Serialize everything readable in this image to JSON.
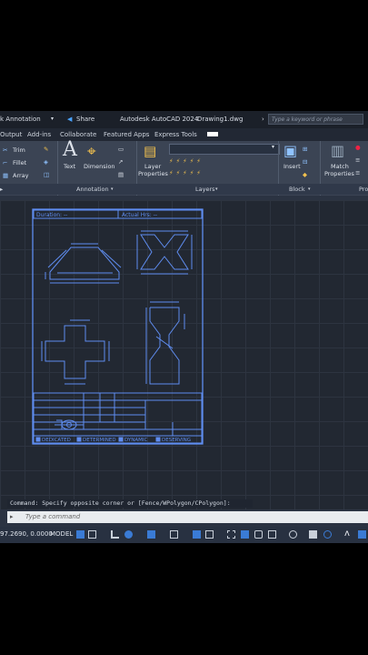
{
  "titlebar": {
    "workspace": "k Annotation",
    "share": "Share",
    "title": "Autodesk AutoCAD 2024",
    "filename": "Drawing1.dwg",
    "search_placeholder": "Type a keyword or phrase"
  },
  "tabs": [
    "Output",
    "Add-ins",
    "Collaborate",
    "Featured Apps",
    "Express Tools"
  ],
  "ribbon": {
    "modify": {
      "trim": "Trim",
      "fillet": "Fillet",
      "array": "Array"
    },
    "annotation": {
      "text": "Text",
      "dimension": "Dimension"
    },
    "layers": {
      "layer_properties_line1": "Layer",
      "layer_properties_line2": "Properties"
    },
    "block": {
      "insert": "Insert"
    },
    "properties": {
      "match_line1": "Match",
      "match_line2": "Properties"
    },
    "panels": {
      "annotation": "Annotation",
      "layers": "Layers",
      "block": "Block",
      "properties_cut": "Pro"
    }
  },
  "drawing": {
    "header_duration": "Duration: --",
    "header_actual": "Actual Hrs: --",
    "checkbox_1": "DEDICATED",
    "checkbox_2": "DETERMINED",
    "checkbox_3": "DYNAMIC",
    "checkbox_4": "DESERVING"
  },
  "command": {
    "history": "Command: Specify opposite corner or [Fence/WPolygon/CPolygon]:",
    "placeholder": "Type a command"
  },
  "status": {
    "coords": "97.2690, 0.0000",
    "model": "MODEL"
  },
  "colors": {
    "accent": "#3a7bd5",
    "sheet_lines": "#5f8df0",
    "background": "#222832"
  }
}
